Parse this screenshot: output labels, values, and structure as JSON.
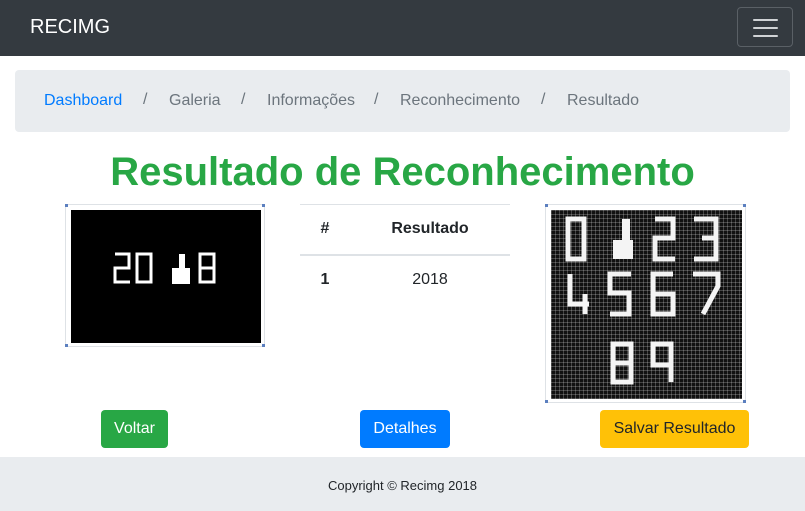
{
  "navbar": {
    "brand": "RECIMG"
  },
  "breadcrumb": {
    "items": [
      {
        "label": "Dashboard"
      },
      {
        "label": "Galeria"
      },
      {
        "label": "Informações"
      },
      {
        "label": "Reconhecimento"
      },
      {
        "label": "Resultado"
      }
    ],
    "separator": "/"
  },
  "page": {
    "title": "Resultado de Reconhecimento"
  },
  "images": {
    "input_digits": "2018",
    "reference_digits": "0123456789"
  },
  "table": {
    "headers": [
      "#",
      "Resultado"
    ],
    "rows": [
      {
        "index": "1",
        "value": "2018"
      }
    ]
  },
  "buttons": {
    "back": "Voltar",
    "details": "Detalhes",
    "save": "Salvar Resultado"
  },
  "colors": {
    "navbar": "#343a40",
    "primary": "#007bff",
    "success": "#28a745",
    "warning": "#ffc107",
    "light": "#e9ecef"
  },
  "footer": {
    "copyright": "Copyright © Recimg 2018"
  }
}
